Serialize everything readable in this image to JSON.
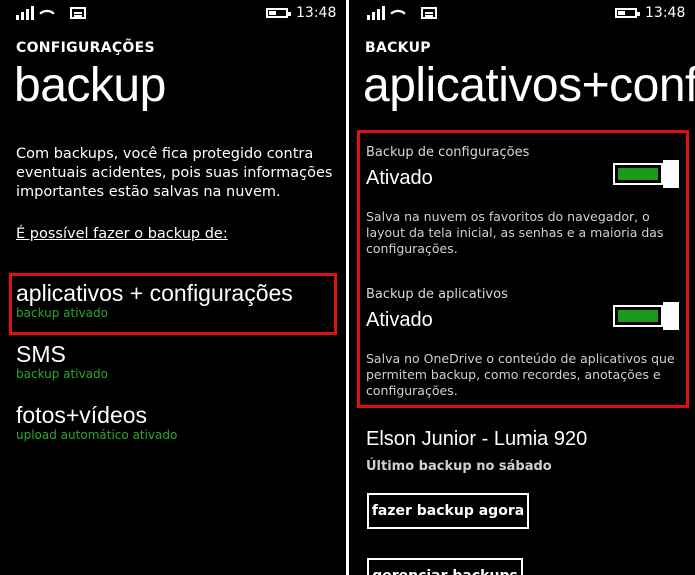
{
  "status": {
    "time": "13:48"
  },
  "left": {
    "app_title": "CONFIGURAÇÕES",
    "page_title": "backup",
    "description": "Com backups, você fica protegido contra eventuais acidentes, pois suas informações importantes estão salvas na nuvem.",
    "backup_of_label": "É possível fazer o backup de:",
    "items": [
      {
        "title": "aplicativos + configurações",
        "subtitle": "backup ativado"
      },
      {
        "title": "SMS",
        "subtitle": "backup ativado"
      },
      {
        "title": "fotos+vídeos",
        "subtitle": "upload automático ativado"
      }
    ]
  },
  "right": {
    "app_title": "BACKUP",
    "page_title": "aplicativos+configurações",
    "settings_backup": {
      "label": "Backup de configurações",
      "value": "Ativado",
      "enabled": true,
      "description": "Salva na nuvem os favoritos do navegador, o layout da tela inicial, as senhas e a maioria das configurações."
    },
    "apps_backup": {
      "label": "Backup de aplicativos",
      "value": "Ativado",
      "enabled": true,
      "description": "Salva no OneDrive o conteúdo de aplicativos que permitem backup, como recordes, anotações e configurações."
    },
    "device_name": "Elson Junior - Lumia 920",
    "last_backup": "Último backup no sábado",
    "backup_now_button": "fazer backup agora",
    "manage_backups_button": "gerenciar backups"
  },
  "colors": {
    "accent": "#1a9a1a",
    "subtitle_green": "#2aa82a",
    "highlight_red": "#e01010"
  }
}
